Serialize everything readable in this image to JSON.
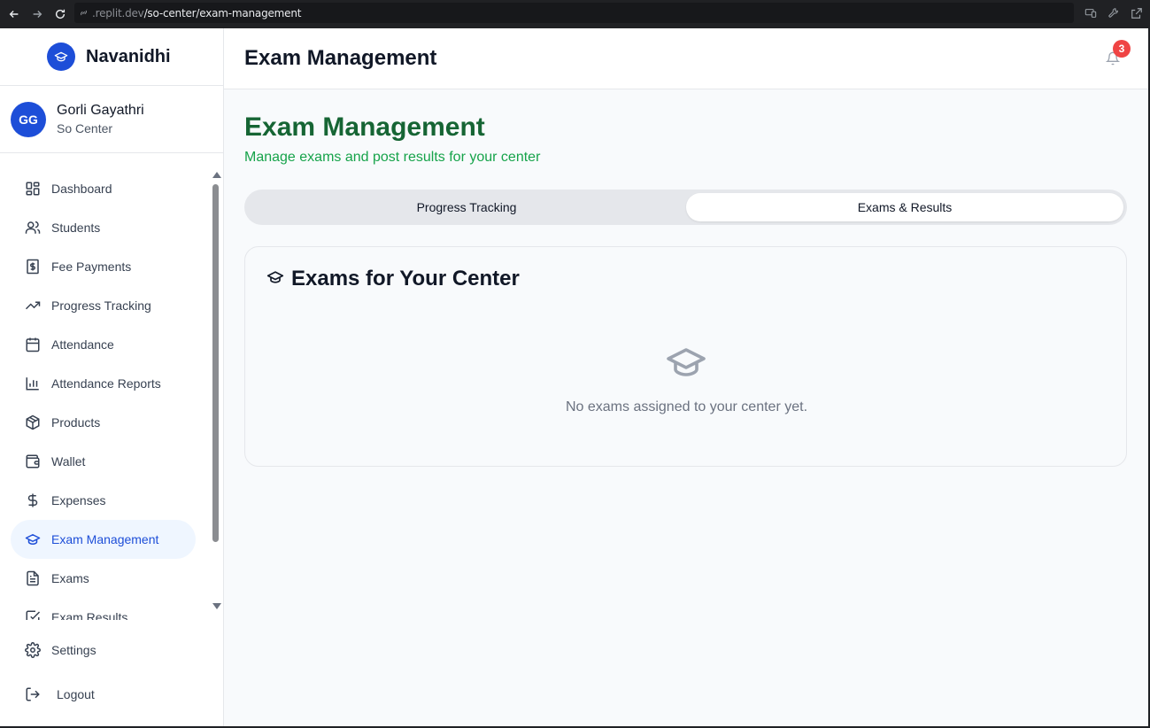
{
  "browser": {
    "url_host": ".replit.dev",
    "url_path": "/so-center/exam-management"
  },
  "brand": {
    "name": "Navanidhi",
    "logo_icon": "graduation-cap-icon"
  },
  "user": {
    "initials": "GG",
    "name": "Gorli Gayathri",
    "role": "So Center"
  },
  "sidebar": {
    "items": [
      {
        "label": "Dashboard",
        "icon": "dashboard-icon"
      },
      {
        "label": "Students",
        "icon": "users-icon"
      },
      {
        "label": "Fee Payments",
        "icon": "receipt-dollar-icon"
      },
      {
        "label": "Progress Tracking",
        "icon": "trending-up-icon"
      },
      {
        "label": "Attendance",
        "icon": "calendar-icon"
      },
      {
        "label": "Attendance Reports",
        "icon": "bar-chart-icon"
      },
      {
        "label": "Products",
        "icon": "package-icon"
      },
      {
        "label": "Wallet",
        "icon": "wallet-icon"
      },
      {
        "label": "Expenses",
        "icon": "dollar-icon"
      },
      {
        "label": "Exam Management",
        "icon": "graduation-cap-icon",
        "active": true
      },
      {
        "label": "Exams",
        "icon": "file-text-icon"
      },
      {
        "label": "Exam Results",
        "icon": "check-square-icon"
      }
    ],
    "settings_label": "Settings",
    "logout_label": "Logout"
  },
  "header": {
    "title": "Exam Management",
    "notification_count": "3"
  },
  "main": {
    "title": "Exam Management",
    "subtitle": "Manage exams and post results for your center",
    "tabs": [
      {
        "label": "Progress Tracking",
        "selected": false
      },
      {
        "label": "Exams & Results",
        "selected": true
      }
    ],
    "card": {
      "title": "Exams for Your Center",
      "empty_message": "No exams assigned to your center yet."
    }
  },
  "colors": {
    "primary": "#1d4ed8",
    "heading_green": "#166534",
    "subtitle_green": "#16a34a",
    "badge_red": "#ef4444"
  }
}
